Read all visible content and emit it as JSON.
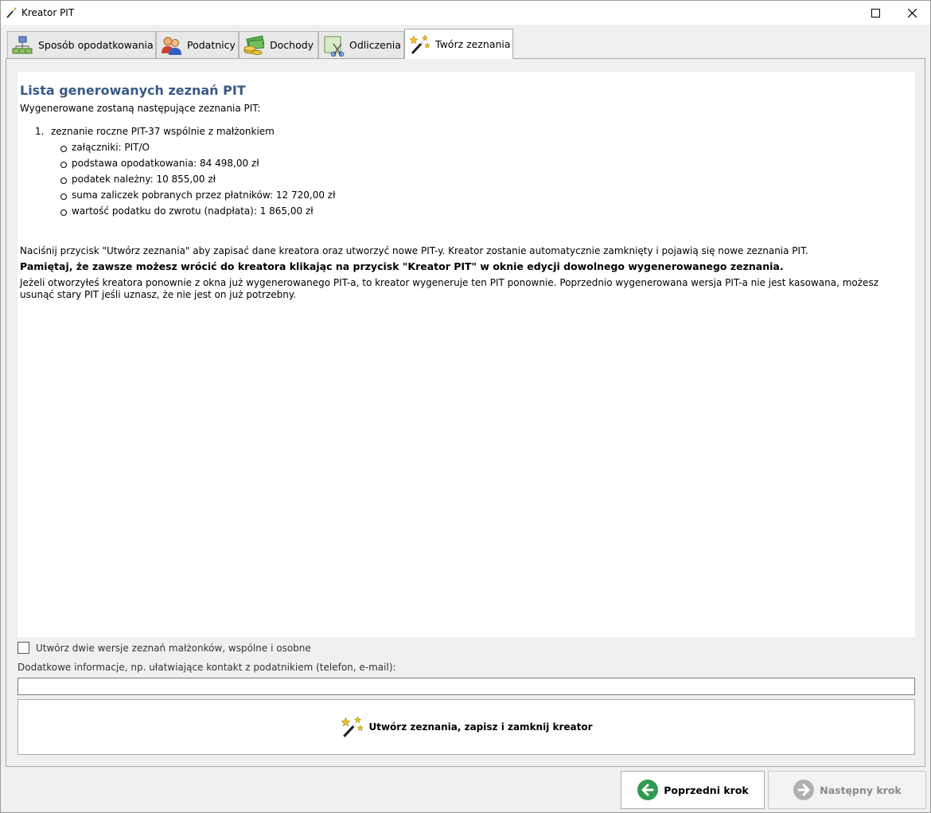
{
  "window": {
    "title": "Kreator PIT"
  },
  "tabs": [
    {
      "label": "Sposób opodatkowania",
      "icon": "network-icon"
    },
    {
      "label": "Podatnicy",
      "icon": "people-icon"
    },
    {
      "label": "Dochody",
      "icon": "money-icon"
    },
    {
      "label": "Odliczenia",
      "icon": "scissors-icon"
    },
    {
      "label": "Twórz zeznania",
      "icon": "magic-wand-icon",
      "active": true
    }
  ],
  "content": {
    "title": "Lista generowanych zeznań PIT",
    "intro": "Wygenerowane zostaną następujące zeznania PIT:",
    "list": [
      {
        "number": "1.",
        "text": "zeznanie roczne PIT-37 wspólnie z małżonkiem",
        "details": [
          "załączniki: PIT/O",
          "podstawa opodatkowania: 84 498,00 zł",
          "podatek należny: 10 855,00 zł",
          "suma zaliczek pobranych przez płatników: 12 720,00 zł",
          "wartość podatku do zwrotu (nadpłata): 1 865,00 zł"
        ]
      }
    ],
    "para1": "Naciśnij przycisk \"Utwórz zeznania\" aby zapisać dane kreatora oraz utworzyć nowe PIT-y. Kreator zostanie automatycznie zamknięty i pojawią się nowe zeznania PIT.",
    "para2": "Pamiętaj, że zawsze możesz wrócić do kreatora klikając na przycisk \"Kreator PIT\" w oknie edycji dowolnego wygenerowanego zeznania.",
    "para3": "Jeżeli otworzyłeś kreatora ponownie z okna już wygenerowanego PIT-a, to kreator wygeneruje ten PIT ponownie. Poprzednio wygenerowana wersja PIT-a nie jest kasowana, możesz usunąć stary PIT jeśli uznasz, że nie jest on już potrzebny."
  },
  "options": {
    "checkbox_label": "Utwórz dwie wersje zeznań małżonków, wspólne i osobne",
    "checkbox_checked": false,
    "additional_label": "Dodatkowe informacje, np. ułatwiające kontakt z podatnikiem (telefon, e-mail):",
    "additional_value": ""
  },
  "buttons": {
    "create": "Utwórz zeznania, zapisz i zamknij kreator",
    "prev": "Poprzedni krok",
    "next": "Następny krok"
  },
  "colors": {
    "title": "#3a5a85",
    "prev_arrow": "#2e9b4e",
    "next_arrow_disabled": "#b0b0b0"
  }
}
